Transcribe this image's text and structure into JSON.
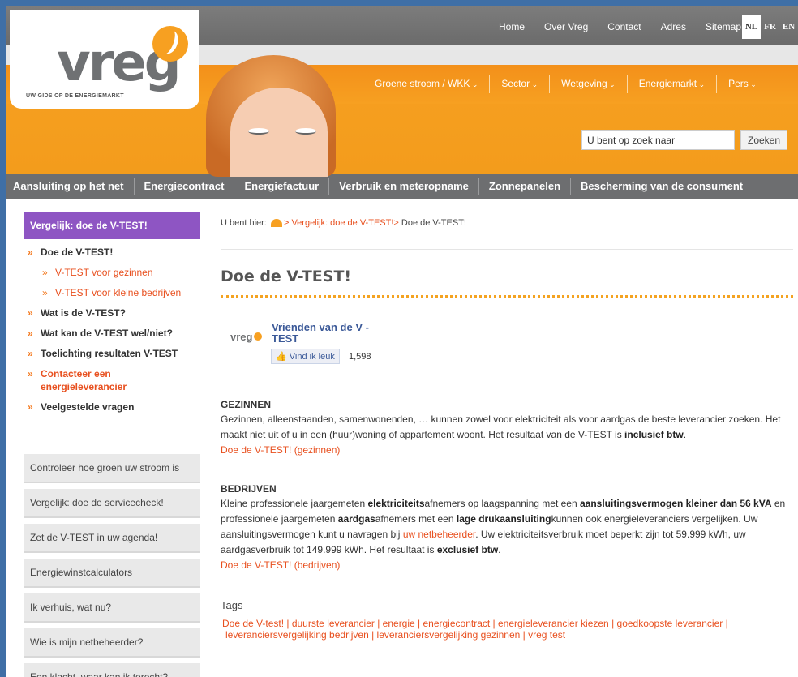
{
  "header": {
    "logo_word": "vreg",
    "logo_tagline": "UW GIDS OP DE ENERGIEMARKT",
    "top_nav": [
      "Home",
      "Over Vreg",
      "Contact",
      "Adres",
      "Sitemap"
    ],
    "languages": [
      "NL",
      "FR",
      "EN"
    ],
    "main_nav": [
      "Groene stroom / WKK",
      "Sector",
      "Wetgeving",
      "Energiemarkt",
      "Pers"
    ],
    "search_value": "U bent op zoek naar",
    "search_button": "Zoeken"
  },
  "subnav": [
    "Aansluiting op het net",
    "Energiecontract",
    "Energiefactuur",
    "Verbruik en meteropname",
    "Zonnepanelen",
    "Bescherming van de consument"
  ],
  "sidebar": {
    "heading": "Vergelijk: doe de V-TEST!",
    "items": [
      {
        "label": "Doe de V-TEST!"
      },
      {
        "label": "V-TEST voor gezinnen"
      },
      {
        "label": "V-TEST voor kleine bedrijven"
      },
      {
        "label": "Wat is de V-TEST?"
      },
      {
        "label": "Wat kan de V-TEST wel/niet?"
      },
      {
        "label": "Toelichting resultaten V-TEST"
      },
      {
        "label": "Contacteer een energieleverancier"
      },
      {
        "label": "Veelgestelde vragen"
      }
    ],
    "boxes": [
      "Controleer hoe groen uw stroom is",
      "Vergelijk: doe de servicecheck!",
      "Zet de V-TEST in uw agenda!",
      "Energiewinstcalculators",
      "Ik verhuis, wat nu?",
      "Wie is mijn netbeheerder?",
      "Een klacht, waar kan ik terecht?"
    ]
  },
  "breadcrumb": {
    "prefix": "U bent hier:",
    "link": "Vergelijk: doe de V-TEST!",
    "current": "Doe de V-TEST!"
  },
  "content": {
    "title": "Doe de V-TEST!",
    "fb": {
      "mini_logo": "vreg",
      "page_name": "Vrienden van de V -TEST",
      "like_label": "Vind ik leuk",
      "count": "1,598"
    },
    "gezinnen": {
      "title": "GEZINNEN",
      "p1": "Gezinnen, alleenstaanden, samenwonenden, … kunnen zowel voor elektriciteit als voor aardgas de beste leverancier zoeken.",
      "p2a": "Het maakt niet uit of u in een (huur)woning of appartement woont. Het resultaat van de V-TEST is ",
      "p2b": "inclusief btw",
      "p2c": ".",
      "link": "Doe de V-TEST! (gezinnen)"
    },
    "bedrijven": {
      "title": "BEDRIJVEN",
      "t1": "Kleine professionele jaargemeten ",
      "t1b": "elektriciteits",
      "t2": "afnemers op laagspanning met een ",
      "t2b": "aansluitingsvermogen kleiner dan 56 kVA",
      "t3": "en professionele jaargemeten ",
      "t3b": "aardgas",
      "t4": "afnemers met een ",
      "t4b": "lage drukaansluiting",
      "t5": "kunnen ook energieleveranciers vergelijken. Uw aansluitingsvermogen kunt u navragen bij ",
      "t5link": "uw netbeheerder",
      "t6": ". Uw elektriciteitsverbruik moet beperkt zijn tot 59.999 kWh, uw aardgasverbruik tot 149.999 kWh. Het resultaat is ",
      "t6b": "exclusief btw",
      "t7": ".",
      "link": "Doe de V-TEST! (bedrijven)"
    },
    "tags_title": "Tags",
    "tags_line1": "Doe de V-test! | duurste leverancier | energie | energiecontract | energieleverancier kiezen | goedkoopste leverancier |",
    "tags_line2": "leveranciersvergelijking bedrijven | leveranciersvergelijking gezinnen | vreg test"
  }
}
